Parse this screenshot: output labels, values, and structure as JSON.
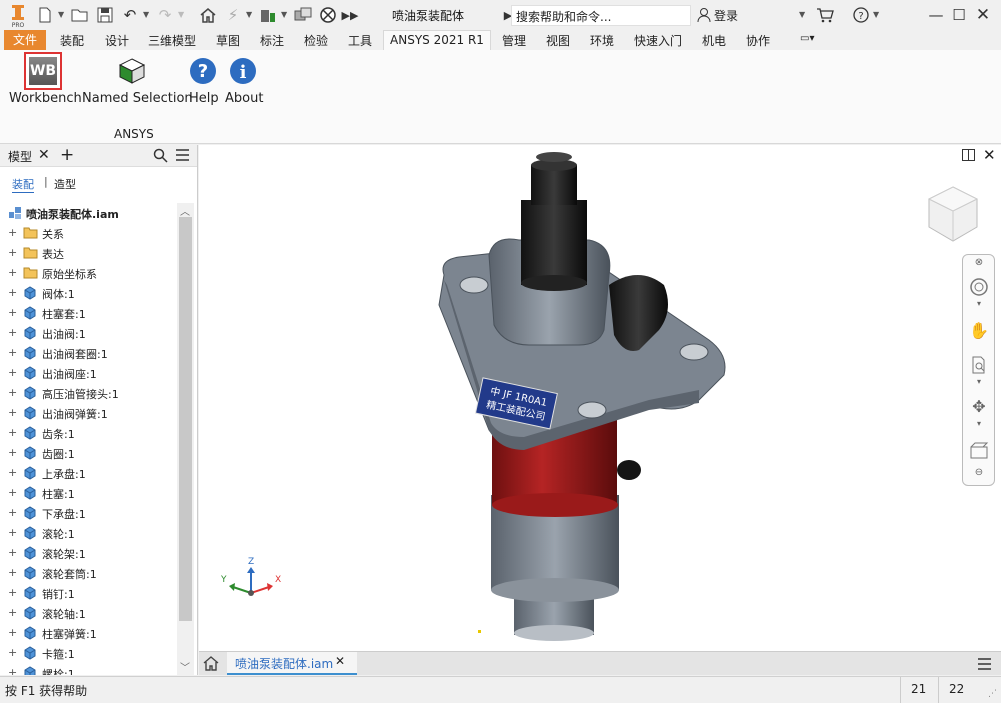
{
  "titlebar": {
    "doc_title": "喷油泵装配体",
    "search_placeholder": "搜索帮助和命令...",
    "login": "登录"
  },
  "menu": {
    "items": [
      "文件",
      "装配",
      "设计",
      "三维模型",
      "草图",
      "标注",
      "检验",
      "工具",
      "ANSYS 2021 R1",
      "管理",
      "视图",
      "环境",
      "快速入门",
      "机电",
      "协作"
    ]
  },
  "ribbon": {
    "workbench_icon_text": "WB",
    "buttons": [
      "Workbench",
      "Named Selection",
      "Help",
      "About"
    ],
    "group_label": "ANSYS"
  },
  "left_panel": {
    "title": "模型",
    "tab_assembly": "装配",
    "tab_modeling": "造型",
    "tree_root": "喷油泵装配体.iam",
    "tree_items": [
      {
        "label": "关系",
        "icon": "folder-icon"
      },
      {
        "label": "表达",
        "icon": "representation-folder-icon"
      },
      {
        "label": "原始坐标系",
        "icon": "folder-icon"
      },
      {
        "label": "阀体:1",
        "icon": "grounded-part-icon"
      },
      {
        "label": "柱塞套:1",
        "icon": "part-icon"
      },
      {
        "label": "出油阀:1",
        "icon": "part-icon"
      },
      {
        "label": "出油阀套圈:1",
        "icon": "part-icon"
      },
      {
        "label": "出油阀座:1",
        "icon": "part-icon"
      },
      {
        "label": "高压油管接头:1",
        "icon": "part-icon"
      },
      {
        "label": "出油阀弹簧:1",
        "icon": "part-icon"
      },
      {
        "label": "齿条:1",
        "icon": "part-icon"
      },
      {
        "label": "齿圈:1",
        "icon": "part-icon"
      },
      {
        "label": "上承盘:1",
        "icon": "part-icon"
      },
      {
        "label": "柱塞:1",
        "icon": "part-icon"
      },
      {
        "label": "下承盘:1",
        "icon": "part-icon"
      },
      {
        "label": "滚轮:1",
        "icon": "part-icon"
      },
      {
        "label": "滚轮架:1",
        "icon": "part-icon"
      },
      {
        "label": "滚轮套筒:1",
        "icon": "part-icon"
      },
      {
        "label": "销钉:1",
        "icon": "part-icon"
      },
      {
        "label": "滚轮轴:1",
        "icon": "part-icon"
      },
      {
        "label": "柱塞弹簧:1",
        "icon": "part-icon"
      },
      {
        "label": "卡箍:1",
        "icon": "part-icon"
      },
      {
        "label": "螺栓:1",
        "icon": "part-icon"
      }
    ]
  },
  "viewport": {
    "nameplate_line1": "中 JF 1R0A1",
    "nameplate_line2": "精工装配公司",
    "triad_x": "X",
    "triad_y": "Y",
    "triad_z": "Z"
  },
  "doc_tabs": {
    "active_tab": "喷油泵装配体.iam"
  },
  "statusbar": {
    "help_text": "按 F1 获得帮助",
    "count1": "21",
    "count2": "22"
  },
  "colors": {
    "file_menu": "#e8872e",
    "accent_blue": "#3d8fcf",
    "part_body": "#7c8590",
    "red_housing": "#9c1c1c"
  }
}
